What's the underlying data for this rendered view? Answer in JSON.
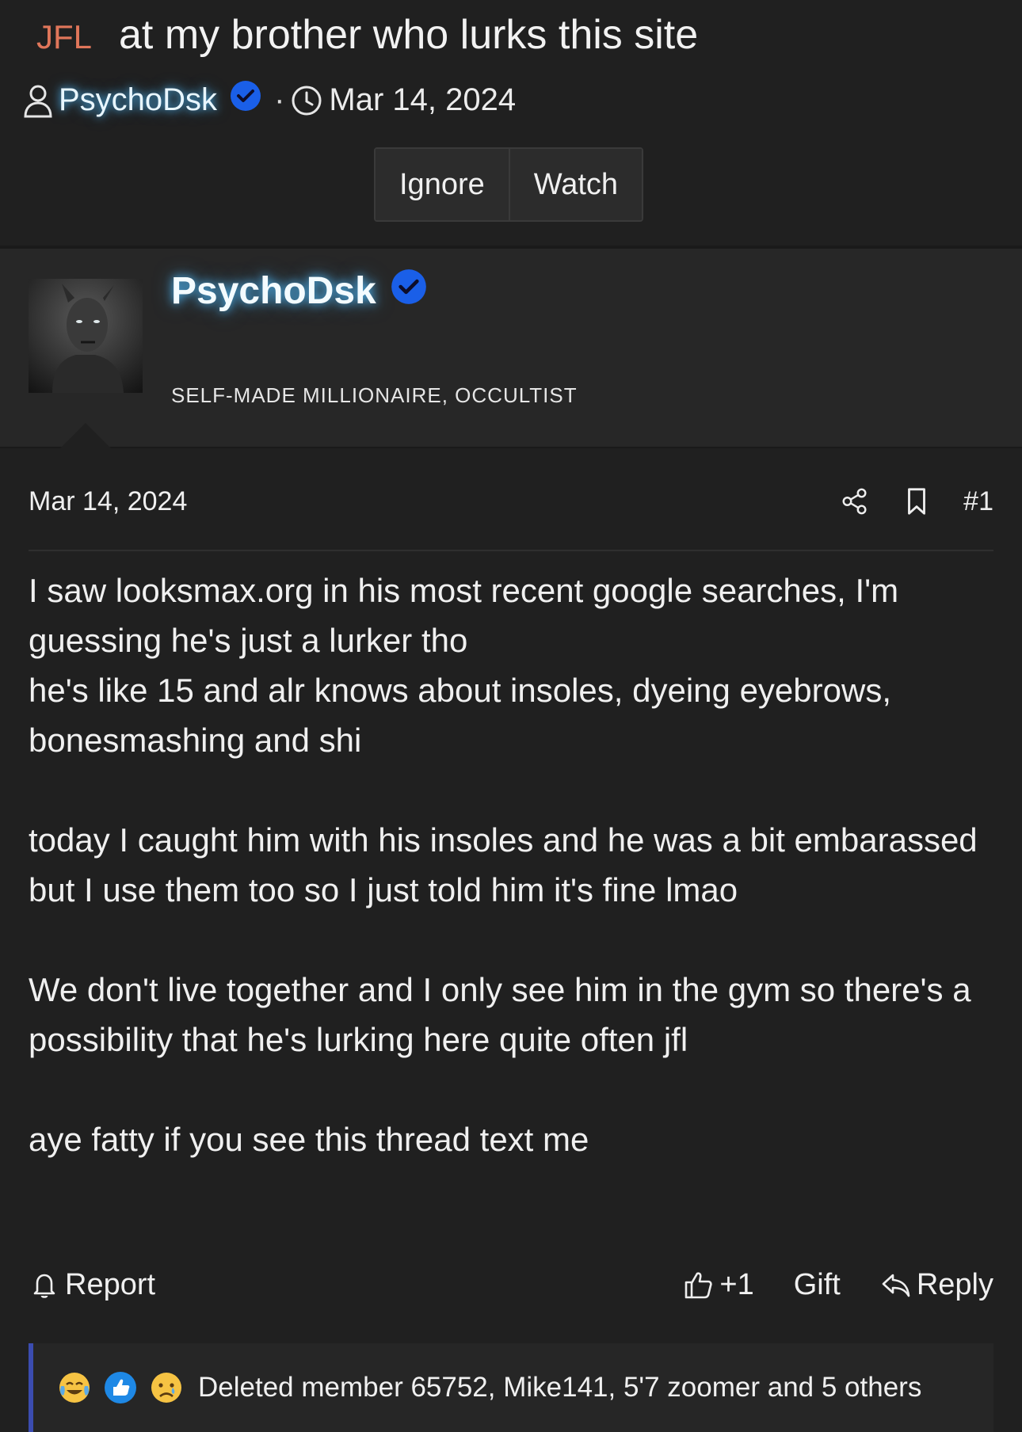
{
  "thread": {
    "prefix": "JFL",
    "title": "at my brother who lurks this site",
    "author": "PsychoDsk",
    "date": "Mar 14, 2024",
    "buttons": {
      "ignore": "Ignore",
      "watch": "Watch"
    }
  },
  "author_block": {
    "name": "PsychoDsk",
    "user_title": "SELF-MADE MILLIONAIRE, OCCULTIST"
  },
  "post": {
    "date": "Mar 14, 2024",
    "number": "#1",
    "paragraphs": [
      "I saw looksmax.org in his most recent google searches, I'm guessing he's just a lurker tho\nhe's like 15 and alr knows about insoles, dyeing eyebrows, bonesmashing and shi",
      "today I caught him with his insoles and he was a bit embarassed but I use them too so I just told him it's fine lmao",
      "We don't live together and I only see him in the gym so there's a possibility that he's lurking here quite often jfl",
      "aye fatty if you see this thread text me"
    ],
    "actions": {
      "report": "Report",
      "like": "+1",
      "gift": "Gift",
      "reply": "Reply"
    },
    "reactions_text": "Deleted member 65752, Mike141, 5'7 zoomer and 5 others"
  },
  "colors": {
    "prefix": "#e0765a",
    "verified": "#1a5fe8",
    "glow": "#50beff",
    "reaction_bar": "#3b4cb0"
  }
}
